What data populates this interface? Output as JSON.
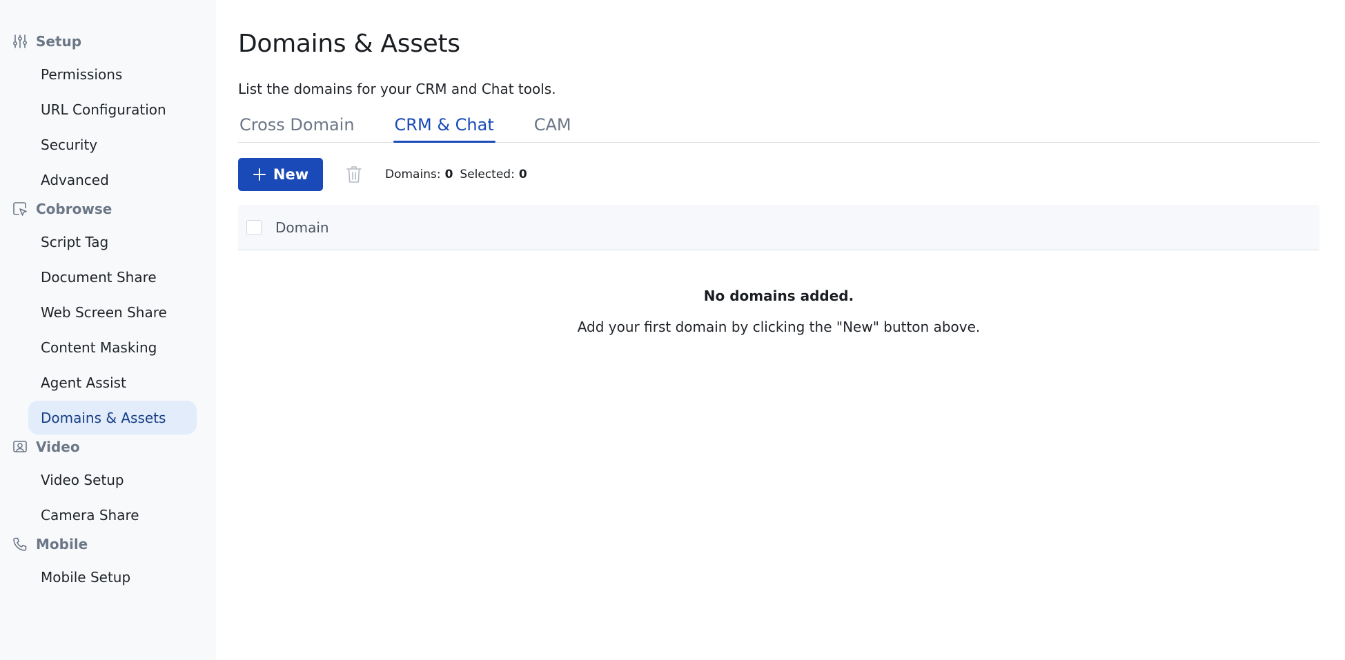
{
  "sidebar": {
    "groups": [
      {
        "label": "Setup",
        "icon": "sliders-icon",
        "items": [
          "Permissions",
          "URL Configuration",
          "Security",
          "Advanced"
        ]
      },
      {
        "label": "Cobrowse",
        "icon": "cobrowse-cursor-icon",
        "items": [
          "Script Tag",
          "Document Share",
          "Web Screen Share",
          "Content Masking",
          "Agent Assist",
          "Domains & Assets"
        ]
      },
      {
        "label": "Video",
        "icon": "video-person-icon",
        "items": [
          "Video Setup",
          "Camera Share"
        ]
      },
      {
        "label": "Mobile",
        "icon": "phone-icon",
        "items": [
          "Mobile Setup"
        ]
      }
    ],
    "active_item": "Domains & Assets"
  },
  "main": {
    "title": "Domains & Assets",
    "description": "List the domains for your CRM and Chat tools.",
    "tabs": [
      {
        "label": "Cross Domain",
        "active": false
      },
      {
        "label": "CRM & Chat",
        "active": true
      },
      {
        "label": "CAM",
        "active": false
      }
    ],
    "toolbar": {
      "new_label": "New",
      "domains_label": "Domains:",
      "domains_count": "0",
      "selected_label": "Selected:",
      "selected_count": "0"
    },
    "table": {
      "column_header": "Domain"
    },
    "empty_state": {
      "title": "No domains added.",
      "subtitle": "Add your first domain by clicking the \"New\" button above."
    }
  },
  "colors": {
    "accent": "#1a4ab8",
    "sidebar_bg": "#f8f9fb",
    "active_item_bg": "#e3ecfa"
  }
}
